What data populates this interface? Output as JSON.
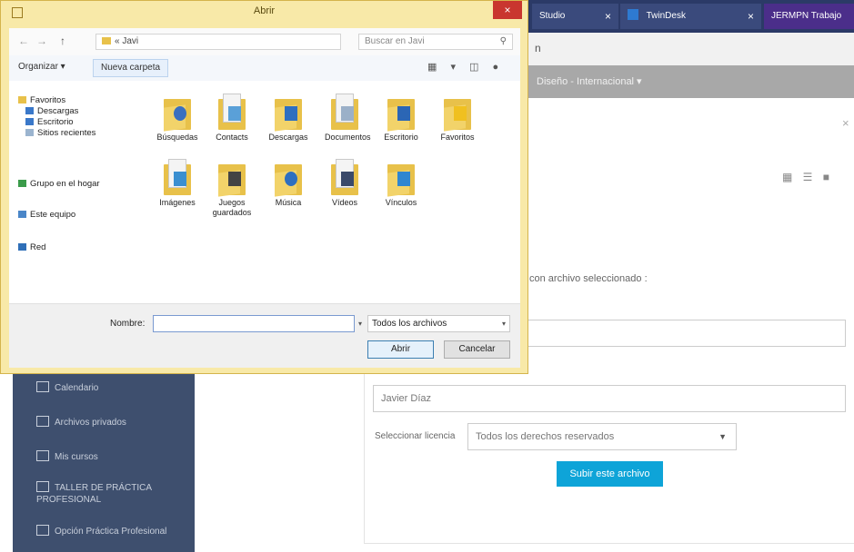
{
  "browser": {
    "tabs": [
      {
        "label": "Studio",
        "close": "×"
      },
      {
        "label": "TwinDesk",
        "close": "×"
      },
      {
        "label": "JERMPN Trabajo",
        "close": ""
      }
    ],
    "address_fragment": "n"
  },
  "site_nav": {
    "label": "Diseño - Internacional ▾"
  },
  "moodle_sidebar": {
    "items": [
      {
        "label": "Calendario"
      },
      {
        "label": "Archivos privados"
      },
      {
        "label": "Mis cursos"
      },
      {
        "label": "TALLER DE PRÁCTICA PROFESIONAL"
      },
      {
        "label": "Opción Práctica Profesional"
      }
    ]
  },
  "moodle_form": {
    "close": "×",
    "view_icons": "▦ ☰ ■",
    "hint": "con archivo seleccionado :",
    "author": "Javier Díaz",
    "license_label": "Seleccionar licencia",
    "license_value": "Todos los derechos reservados",
    "license_caret": "▼",
    "upload_button": "Subir este archivo"
  },
  "dialog": {
    "title": "Abrir",
    "close": "×",
    "nav": {
      "back": "←",
      "forward": "→",
      "up": "↑",
      "path": "« Javi",
      "path_dd": "▾",
      "refresh": "↻",
      "search_placeholder": "Buscar en Javi",
      "search_icon": "⚲"
    },
    "toolbar": {
      "organize": "Organizar ▾",
      "new_folder": "Nueva carpeta",
      "icons": "▦ ▾ ◫ ●"
    },
    "nav_pane": [
      {
        "label": "Favoritos",
        "color": "#e8c14a"
      },
      {
        "label": "Descargas",
        "color": "#3a78c9"
      },
      {
        "label": "Escritorio",
        "color": "#3a78c9"
      },
      {
        "label": "Sitios recientes",
        "color": "#9bb4cf"
      },
      {
        "label": "Grupo en el hogar",
        "color": "#3a9b4a"
      },
      {
        "label": "Este equipo",
        "color": "#4a86c8"
      },
      {
        "label": "Red",
        "color": "#2f6fb8"
      }
    ],
    "files": [
      {
        "label": "Búsquedas",
        "badge": "#3a6fc0"
      },
      {
        "label": "Contacts",
        "badge": "#5aa0d8"
      },
      {
        "label": "Descargas",
        "badge": "#2e6fc0"
      },
      {
        "label": "Documentos",
        "badge": "#9bb0c8"
      },
      {
        "label": "Escritorio",
        "badge": "#2b66b5"
      },
      {
        "label": "Favoritos",
        "badge": "#f0c020"
      },
      {
        "label": "Imágenes",
        "badge": "#3b8fd0"
      },
      {
        "label": "Juegos guardados",
        "badge": "#444444"
      },
      {
        "label": "Música",
        "badge": "#2e6fc0"
      },
      {
        "label": "Vídeos",
        "badge": "#3a4a6a"
      },
      {
        "label": "Vínculos",
        "badge": "#2f86d0"
      }
    ],
    "filename_label": "Nombre:",
    "filename_value": "",
    "filename_dd": "▾",
    "filter": "Todos los archivos",
    "filter_caret": "▾",
    "open_button": "Abrir",
    "cancel_button": "Cancelar"
  },
  "colors": {
    "dialog_frame": "#f8e9a8",
    "close_red": "#c9362f",
    "upload_button": "#0ea4d8",
    "sidebar": "#3e4f6e"
  }
}
